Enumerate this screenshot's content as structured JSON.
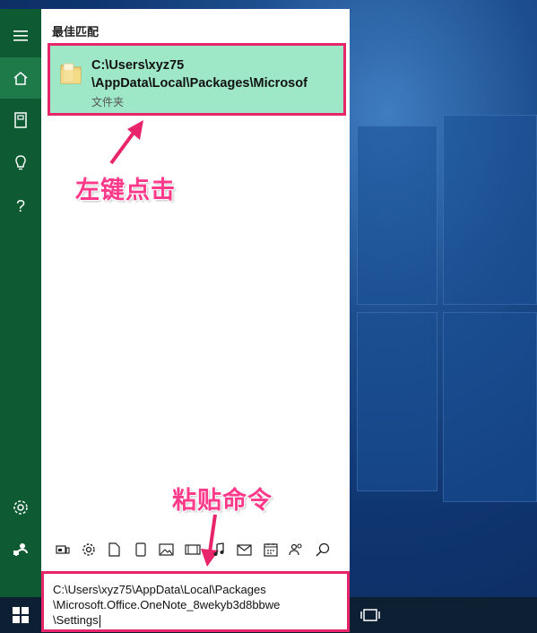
{
  "desktop": {
    "accent": "#0e5a33",
    "highlight": "#9ee8c8",
    "annotation_color": "#ff3a8a"
  },
  "rail": {
    "items": [
      {
        "icon": "hamburger-icon"
      },
      {
        "icon": "home-icon"
      },
      {
        "icon": "notebook-icon"
      },
      {
        "icon": "lightbulb-icon"
      },
      {
        "icon": "help-icon",
        "glyph": "?"
      },
      {
        "icon": "gear-icon"
      },
      {
        "icon": "feedback-icon"
      }
    ]
  },
  "results": {
    "section_label": "最佳匹配",
    "best_match": {
      "icon": "folder-icon",
      "title_line1": "C:\\Users\\xyz75",
      "title_line2": "\\AppData\\Local\\Packages\\Microsof",
      "subtitle": "文件夹"
    }
  },
  "annotations": {
    "left_click": "左键点击",
    "paste_command": "粘贴命令"
  },
  "filters": [
    "apps-icon",
    "settings-icon",
    "document-icon",
    "tablet-icon",
    "photo-icon",
    "video-icon",
    "music-icon",
    "mail-icon",
    "calendar-icon",
    "people-icon",
    "search-icon"
  ],
  "search": {
    "line1": "C:\\Users\\xyz75\\AppData\\Local\\Packages",
    "line2": "\\Microsoft.Office.OneNote_8wekyb3d8bbwe",
    "line3": "\\Settings"
  },
  "taskbar": {
    "start_icon": "windows-logo-icon",
    "taskview_icon": "task-view-icon"
  }
}
